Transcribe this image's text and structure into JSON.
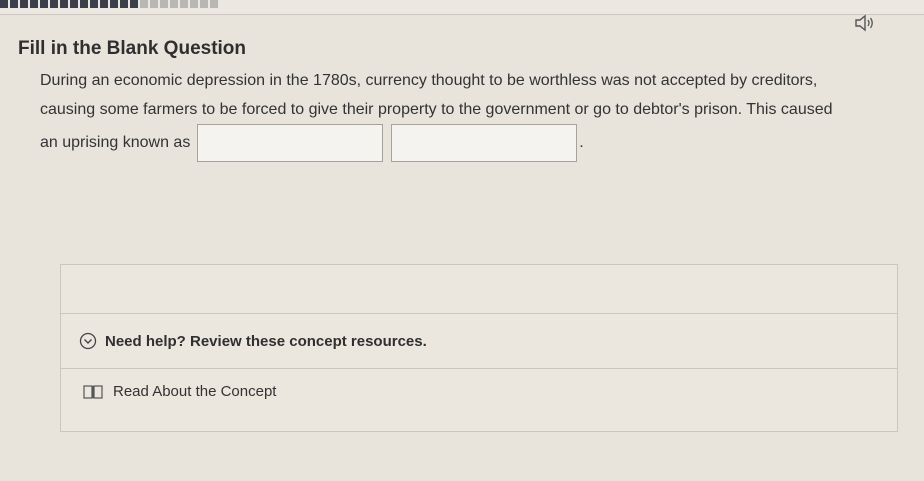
{
  "header": {
    "progress": {
      "completed": 14,
      "pending": 8
    }
  },
  "question": {
    "type_title": "Fill in the Blank Question",
    "text_before": "During an economic depression in the 1780s, currency thought to be worthless was not accepted by creditors, causing some farmers to be forced to give their property to the government or go to debtor's prison. This caused an uprising known as",
    "text_after": "."
  },
  "help": {
    "toggle_label": "Need help? Review these concept resources.",
    "resources": [
      {
        "label": "Read About the Concept"
      }
    ]
  },
  "icons": {
    "speaker": "speaker-icon",
    "toggle": "chevron-circle-icon",
    "resource": "book-icon"
  }
}
